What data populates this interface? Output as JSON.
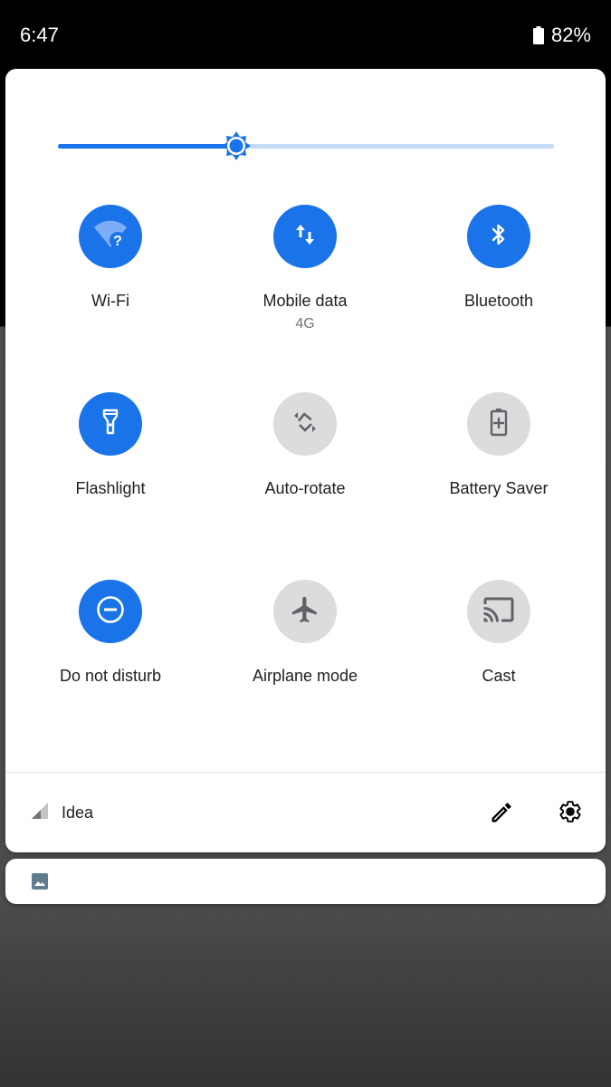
{
  "status_bar": {
    "time": "6:47",
    "battery_percent": "82%",
    "battery_icon": "battery-icon"
  },
  "brightness": {
    "level_fraction": 0.36,
    "icon": "brightness-icon",
    "color_active": "#1a73e8",
    "color_inactive": "#c4dbf7"
  },
  "tiles": [
    {
      "id": "wifi",
      "label": "Wi-Fi",
      "sublabel": "",
      "state": "on",
      "icon": "wifi-unknown-icon"
    },
    {
      "id": "mobile-data",
      "label": "Mobile data",
      "sublabel": "4G",
      "state": "on",
      "icon": "mobile-data-icon"
    },
    {
      "id": "bluetooth",
      "label": "Bluetooth",
      "sublabel": "",
      "state": "on",
      "icon": "bluetooth-icon"
    },
    {
      "id": "flashlight",
      "label": "Flashlight",
      "sublabel": "",
      "state": "on",
      "icon": "flashlight-icon"
    },
    {
      "id": "auto-rotate",
      "label": "Auto-rotate",
      "sublabel": "",
      "state": "off",
      "icon": "auto-rotate-icon"
    },
    {
      "id": "battery-saver",
      "label": "Battery Saver",
      "sublabel": "",
      "state": "off",
      "icon": "battery-saver-icon"
    },
    {
      "id": "do-not-disturb",
      "label": "Do not disturb",
      "sublabel": "",
      "state": "on",
      "icon": "do-not-disturb-icon"
    },
    {
      "id": "airplane-mode",
      "label": "Airplane mode",
      "sublabel": "",
      "state": "off",
      "icon": "airplane-icon"
    },
    {
      "id": "cast",
      "label": "Cast",
      "sublabel": "",
      "state": "off",
      "icon": "cast-icon"
    }
  ],
  "footer": {
    "carrier": "Idea",
    "signal_icon": "signal-icon",
    "edit_icon": "edit-pencil-icon",
    "settings_icon": "gear-icon"
  },
  "notification": {
    "icon": "image-icon"
  },
  "colors": {
    "accent": "#1a73e8",
    "tile_off": "#dcdcdc",
    "icon_off": "#5f6368"
  }
}
